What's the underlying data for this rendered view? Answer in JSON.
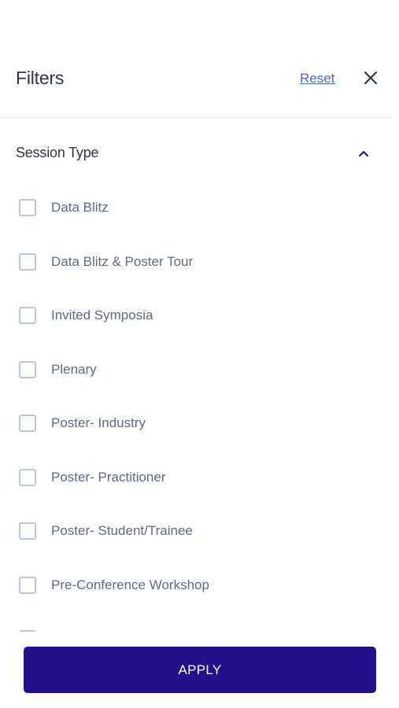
{
  "header": {
    "title": "Filters",
    "reset_label": "Reset",
    "close_icon": "close-icon"
  },
  "section": {
    "title": "Session Type",
    "expanded": true,
    "chevron_icon": "chevron-up-icon"
  },
  "options": [
    {
      "label": "Data Blitz",
      "checked": false
    },
    {
      "label": "Data Blitz & Poster Tour",
      "checked": false
    },
    {
      "label": "Invited Symposia",
      "checked": false
    },
    {
      "label": "Plenary",
      "checked": false
    },
    {
      "label": "Poster- Industry",
      "checked": false
    },
    {
      "label": "Poster- Practitioner",
      "checked": false
    },
    {
      "label": "Poster- Student/Trainee",
      "checked": false
    },
    {
      "label": "Pre-Conference Workshop",
      "checked": false
    }
  ],
  "footer": {
    "apply_label": "APPLY"
  },
  "colors": {
    "primary_button": "#23108a",
    "link": "#4a69c6",
    "checkbox_border": "#b9c7dd"
  }
}
